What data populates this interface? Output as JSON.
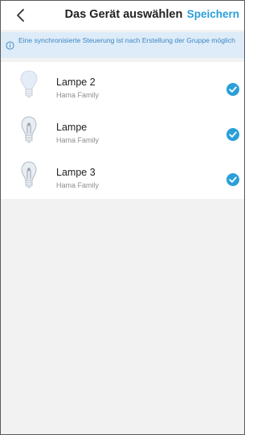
{
  "header": {
    "title": "Das Gerät auswählen",
    "save_label": "Speichern"
  },
  "info": {
    "text": "Eine synchronisierte Steuerung ist nach Erstellung der Gruppe möglich"
  },
  "devices": [
    {
      "name": "Lampe 2",
      "subtitle": "Hama Family",
      "icon": "bulb-white-icon",
      "selected": true
    },
    {
      "name": "Lampe",
      "subtitle": "Hama Family",
      "icon": "bulb-filament-icon",
      "selected": true
    },
    {
      "name": "Lampe 3",
      "subtitle": "Hama Family",
      "icon": "bulb-filament-icon",
      "selected": true
    }
  ],
  "colors": {
    "accent": "#2b9fd9",
    "banner_bg": "#ddecf8",
    "banner_text": "#3f86c4",
    "page_bg": "#f2f2f2"
  }
}
